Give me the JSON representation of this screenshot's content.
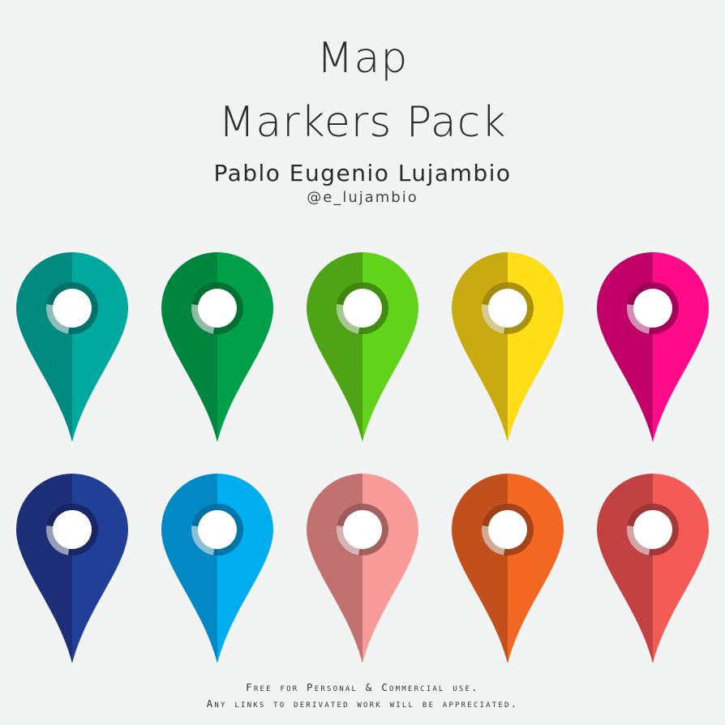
{
  "header": {
    "title_line1": "Map",
    "title_line2": "Markers Pack",
    "author": "Pablo Eugenio Lujambio",
    "handle": "@e_lujambio"
  },
  "markers": [
    {
      "name": "teal-marker",
      "left_color": "#008a80",
      "right_color": "#00a99d"
    },
    {
      "name": "green-marker",
      "left_color": "#00853f",
      "right_color": "#00a04a"
    },
    {
      "name": "lime-marker",
      "left_color": "#4ea414",
      "right_color": "#62d31b"
    },
    {
      "name": "yellow-marker",
      "left_color": "#c9aa10",
      "right_color": "#ffde17"
    },
    {
      "name": "magenta-marker",
      "left_color": "#c10068",
      "right_color": "#ff0b8a"
    },
    {
      "name": "navy-marker",
      "left_color": "#1d2f78",
      "right_color": "#223f98"
    },
    {
      "name": "sky-marker",
      "left_color": "#0289c5",
      "right_color": "#00aeef"
    },
    {
      "name": "pink-marker",
      "left_color": "#c07170",
      "right_color": "#f89b99"
    },
    {
      "name": "orange-marker",
      "left_color": "#c2501d",
      "right_color": "#f26722"
    },
    {
      "name": "red-marker",
      "left_color": "#c24242",
      "right_color": "#f45b56"
    }
  ],
  "footer": {
    "line1": "Free for Personal & Commercial use.",
    "line2": "Any links to derivated work will be appreciated."
  }
}
